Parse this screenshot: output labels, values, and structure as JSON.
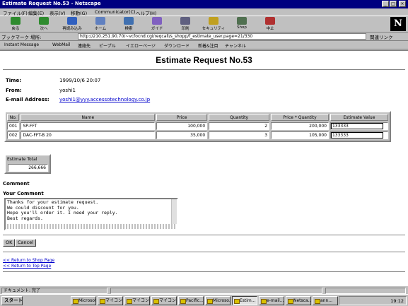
{
  "window": {
    "title": "Estimate Request No.53 - Netscape",
    "controls": [
      "_",
      "□",
      "×"
    ]
  },
  "menu": [
    "ファイル(F)",
    "編集(E)",
    "表示(V)",
    "移動(G)",
    "Communicator(C)",
    "ヘルプ(H)"
  ],
  "toolbar": {
    "buttons": [
      {
        "label": "戻る",
        "icon": "back-arrow-icon",
        "color": "#2e8b2e"
      },
      {
        "label": "次へ",
        "icon": "forward-arrow-icon",
        "color": "#2e8b2e"
      },
      {
        "label": "再読み込み",
        "icon": "reload-icon",
        "color": "#3060c0"
      },
      {
        "label": "ホーム",
        "icon": "home-icon",
        "color": "#6080c0"
      },
      {
        "label": "検索",
        "icon": "search-icon",
        "color": "#4070b0"
      },
      {
        "label": "ガイド",
        "icon": "guide-icon",
        "color": "#8060c0"
      },
      {
        "label": "印刷",
        "icon": "print-icon",
        "color": "#606080"
      },
      {
        "label": "セキュリティ",
        "icon": "security-icon",
        "color": "#c0a020"
      },
      {
        "label": "Shop",
        "icon": "shop-icon",
        "color": "#507050"
      },
      {
        "label": "中止",
        "icon": "stop-icon",
        "color": "#b03030"
      }
    ],
    "logo": "N"
  },
  "address": {
    "label": "ブックマーク  場所:",
    "url": "http://210.251.90.70/~vcfocnd.cgi/reqcall/s_shopp/f_estimate_user.page=21/330",
    "go_label": "関連リンク"
  },
  "links": [
    "Instant Message",
    "WebMail",
    "連絡先",
    "ピープル",
    "イエローページ",
    "ダウンロード",
    "新着&注目",
    "チャンネル"
  ],
  "page": {
    "title": "Estimate Request No.53",
    "time_label": "Time:",
    "time_value": "1999/10/6 20:07",
    "from_label": "From:",
    "from_value": "yoshi1",
    "email_label": "E-mail Address:",
    "email_value": "yoshi1@yyy.accessotechnology.co.jp",
    "table": {
      "headers": [
        "No.",
        "Name",
        "Price",
        "Quantity",
        "Price * Quantity",
        "Estimate Value"
      ],
      "rows": [
        {
          "no": "001",
          "name": "SP-FFT",
          "price": "100,000",
          "quantity": "2",
          "total": "200,000",
          "estimate": "133333"
        },
        {
          "no": "002",
          "name": "DAC-FFT-B 20",
          "price": "35,000",
          "quantity": "3",
          "total": "105,000",
          "estimate": "133333"
        }
      ]
    },
    "estimate_total_label": "Estimate Total",
    "estimate_total_value": "266,666",
    "comment_heading": "Comment",
    "your_comment_label": "Your Comment",
    "comment_lines": [
      "Thanks for your estimate request.",
      "We could discount for you.",
      "Hope you'll order it. I need your reply.",
      "Best regards."
    ],
    "ok_label": "OK",
    "cancel_label": "Cancel",
    "link_back": "<< Return to Shop Page",
    "link_top": "<< Return to Top Page"
  },
  "status": {
    "text": "ドキュメント: 完了"
  },
  "taskbar": {
    "start": "スタート",
    "tasks": [
      "Microsoft...",
      "マイコン...",
      "マイコン...",
      "マイコン...",
      "Pacific...",
      "Microso...",
      "Estim...",
      "e-mail...",
      "Netsca...",
      "ann..."
    ],
    "active_index": 6,
    "clock": "19:12"
  }
}
